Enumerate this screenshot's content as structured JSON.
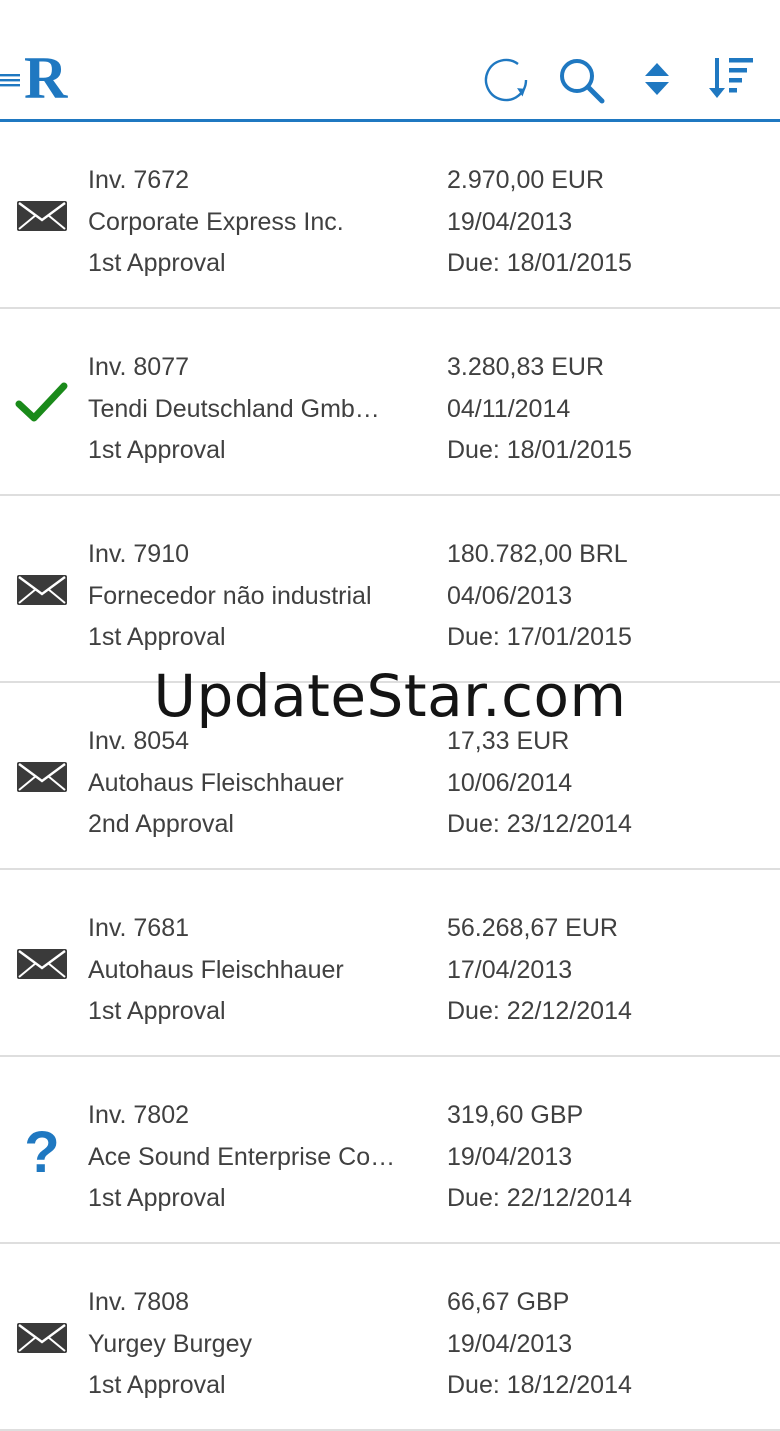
{
  "header": {
    "logo_letter": "R",
    "icons": [
      "menu-icon",
      "refresh-icon",
      "search-icon",
      "sort-toggle-icon",
      "sort-descending-icon"
    ],
    "accent_color": "#1f78c1"
  },
  "invoices": [
    {
      "number": "Inv. 7672",
      "vendor": "Corporate Express Inc.",
      "stage": "1st Approval",
      "amount": "2.970,00 EUR",
      "date": "19/04/2013",
      "due": "Due: 18/01/2015",
      "status_icon": "envelope-icon"
    },
    {
      "number": "Inv. 8077",
      "vendor": "Tendi Deutschland Gmb…",
      "stage": "1st Approval",
      "amount": "3.280,83 EUR",
      "date": "04/11/2014",
      "due": "Due: 18/01/2015",
      "status_icon": "checkmark-icon"
    },
    {
      "number": "Inv. 7910",
      "vendor": "Fornecedor não industrial",
      "stage": "1st Approval",
      "amount": "180.782,00 BRL",
      "date": "04/06/2013",
      "due": "Due: 17/01/2015",
      "status_icon": "envelope-icon"
    },
    {
      "number": "Inv. 8054",
      "vendor": "Autohaus Fleischhauer",
      "stage": "2nd Approval",
      "amount": "17,33 EUR",
      "date": "10/06/2014",
      "due": "Due: 23/12/2014",
      "status_icon": "envelope-icon"
    },
    {
      "number": "Inv. 7681",
      "vendor": "Autohaus Fleischhauer",
      "stage": "1st Approval",
      "amount": "56.268,67 EUR",
      "date": "17/04/2013",
      "due": "Due: 22/12/2014",
      "status_icon": "envelope-icon"
    },
    {
      "number": "Inv. 7802",
      "vendor": "Ace Sound Enterprise Co…",
      "stage": "1st Approval",
      "amount": "319,60 GBP",
      "date": "19/04/2013",
      "due": "Due: 22/12/2014",
      "status_icon": "question-icon"
    },
    {
      "number": "Inv. 7808",
      "vendor": "Yurgey Burgey",
      "stage": "1st Approval",
      "amount": "66,67 GBP",
      "date": "19/04/2013",
      "due": "Due: 18/12/2014",
      "status_icon": "envelope-icon"
    }
  ],
  "status_colors": {
    "checkmark": "#1a8a1a",
    "question": "#1f78c1",
    "envelope": "#3a3a3a"
  },
  "watermark": "UpdateStar.com"
}
